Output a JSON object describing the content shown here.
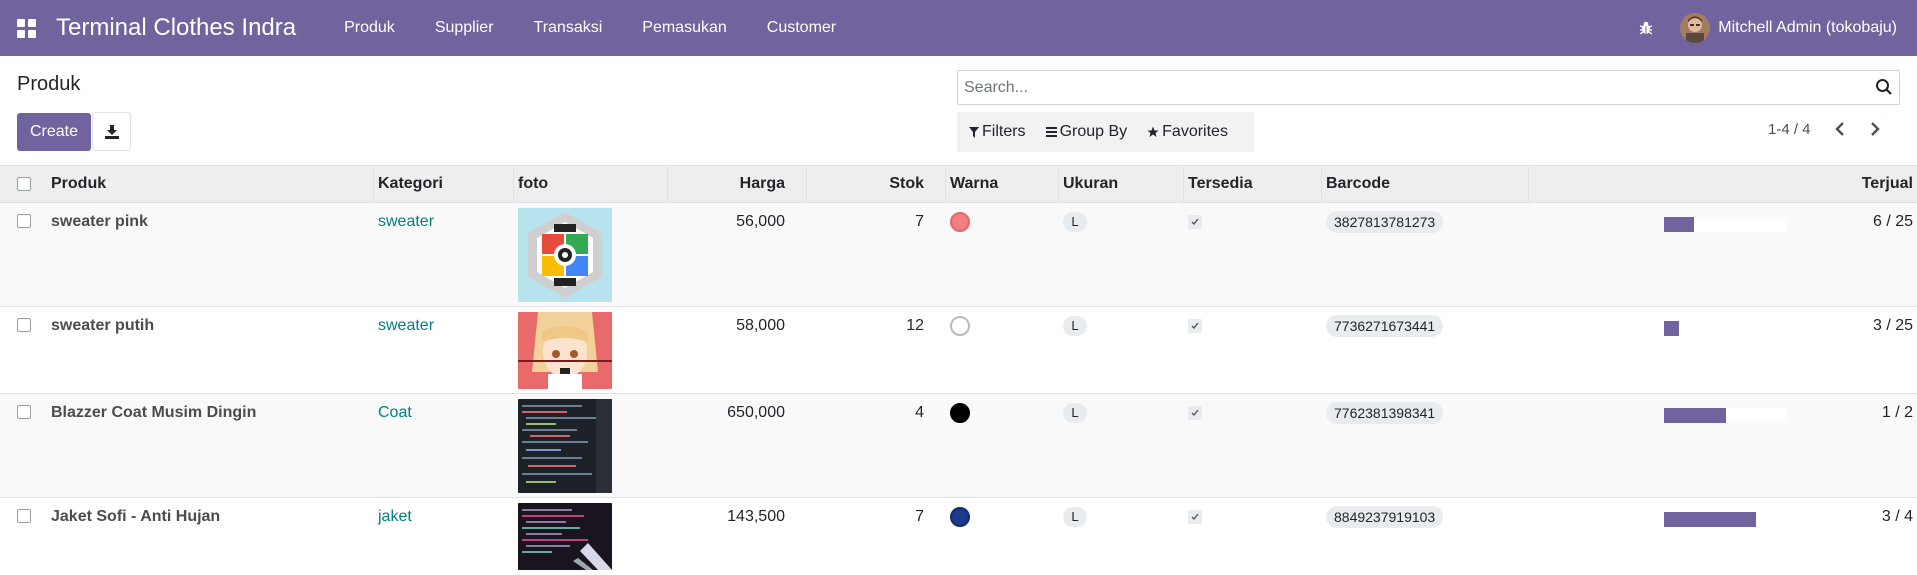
{
  "navbar": {
    "brand": "Terminal Clothes Indra",
    "menu": [
      "Produk",
      "Supplier",
      "Transaksi",
      "Pemasukan",
      "Customer"
    ],
    "user": "Mitchell Admin (tokobaju)"
  },
  "control_panel": {
    "title": "Produk",
    "create_label": "Create",
    "search_placeholder": "Search...",
    "filters_label": "Filters",
    "groupby_label": "Group By",
    "favorites_label": "Favorites",
    "pager": "1-4 / 4"
  },
  "table": {
    "headers": [
      "Produk",
      "Kategori",
      "foto",
      "Harga",
      "Stok",
      "Warna",
      "Ukuran",
      "Tersedia",
      "Barcode",
      "Terjual"
    ],
    "rows": [
      {
        "name": "sweater pink",
        "category": "sweater",
        "price": "56,000",
        "stock": "7",
        "color": "#f08080",
        "size": "L",
        "barcode": "3827813781273",
        "sold": "6 / 25",
        "sold_fraction": 0.24
      },
      {
        "name": "sweater putih",
        "category": "sweater",
        "price": "58,000",
        "stock": "12",
        "color": "#ffffff",
        "size": "L",
        "barcode": "7736271673441",
        "sold": "3 / 25",
        "sold_fraction": 0.12
      },
      {
        "name": "Blazzer Coat Musim Dingin",
        "category": "Coat",
        "price": "650,000",
        "stock": "4",
        "color": "#000000",
        "size": "L",
        "barcode": "7762381398341",
        "sold": "1 / 2",
        "sold_fraction": 0.5
      },
      {
        "name": "Jaket Sofi - Anti Hujan",
        "category": "jaket",
        "price": "143,500",
        "stock": "7",
        "color": "#1a3a8c",
        "size": "L",
        "barcode": "8849237919103",
        "sold": "3 / 4",
        "sold_fraction": 0.75
      }
    ]
  }
}
